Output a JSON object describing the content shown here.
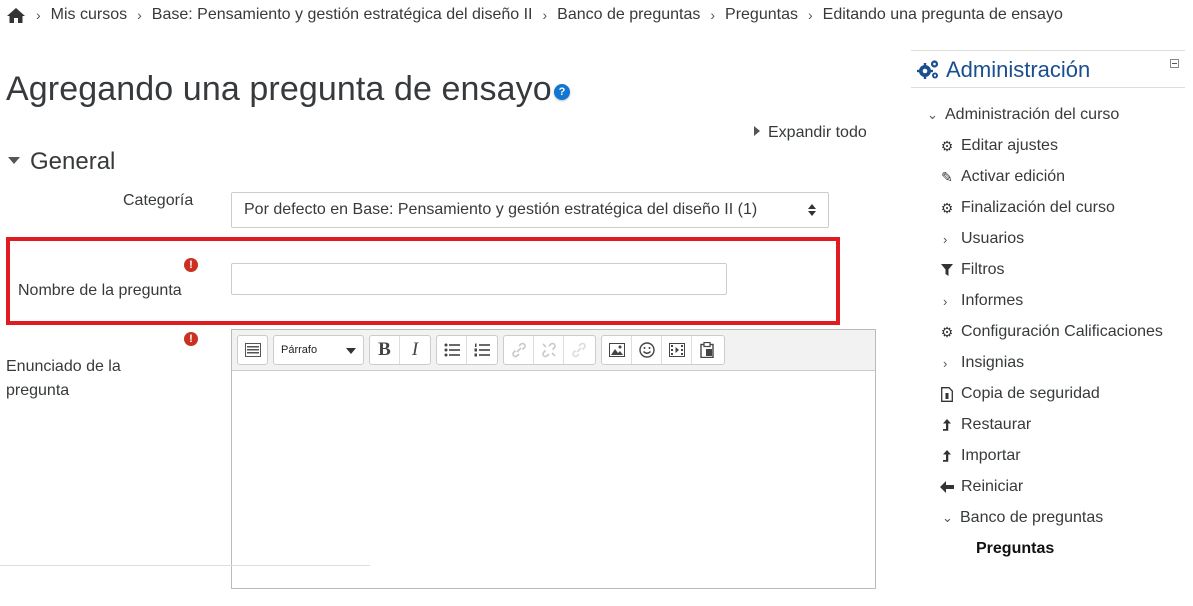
{
  "breadcrumb": {
    "items": [
      "Mis cursos",
      "Base: Pensamiento y gestión estratégica del diseño II",
      "Banco de preguntas",
      "Preguntas",
      "Editando una pregunta de ensayo"
    ]
  },
  "page": {
    "title": "Agregando una pregunta de ensayo",
    "help": "?",
    "expand_all": "Expandir todo"
  },
  "form": {
    "section_general": "General",
    "category_label": "Categoría",
    "category_value": "Por defecto en Base: Pensamiento y gestión estratégica del diseño II (1)",
    "name_label": "Nombre de la pregunta",
    "name_value": "",
    "statement_label": "Enunciado de la pregunta",
    "required_mark": "!",
    "editor": {
      "paragraph_label": "Párrafo",
      "bold": "B",
      "italic": "I"
    }
  },
  "sidebar": {
    "title": "Administración",
    "items": [
      {
        "label": "Administración del curso",
        "icon": "chevron-down-icon"
      },
      {
        "label": "Editar ajustes",
        "icon": "gear-icon"
      },
      {
        "label": "Activar edición",
        "icon": "pencil-icon"
      },
      {
        "label": "Finalización del curso",
        "icon": "gear-icon"
      },
      {
        "label": "Usuarios",
        "icon": "chevron-right-icon"
      },
      {
        "label": "Filtros",
        "icon": "filter-icon"
      },
      {
        "label": "Informes",
        "icon": "chevron-right-icon"
      },
      {
        "label": "Configuración Calificaciones",
        "icon": "gear-icon"
      },
      {
        "label": "Insignias",
        "icon": "chevron-right-icon"
      },
      {
        "label": "Copia de seguridad",
        "icon": "file-icon"
      },
      {
        "label": "Restaurar",
        "icon": "level-up-icon"
      },
      {
        "label": "Importar",
        "icon": "level-up-icon"
      },
      {
        "label": "Reiniciar",
        "icon": "arrow-left-icon"
      },
      {
        "label": "Banco de preguntas",
        "icon": "chevron-down-icon"
      },
      {
        "label": "Preguntas",
        "icon": ""
      }
    ]
  },
  "colors": {
    "accent": "#1a4e8f",
    "highlight": "#e11b22",
    "required": "#ca3120",
    "help": "#1177d1"
  }
}
